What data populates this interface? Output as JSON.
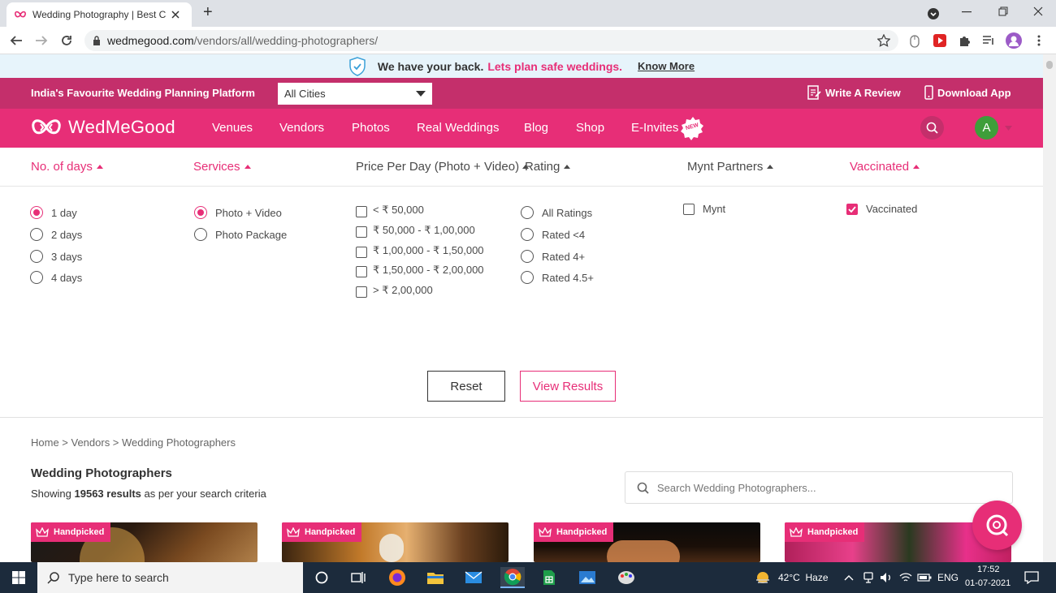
{
  "browser": {
    "tab_title": "Wedding Photography | Best Ca",
    "url_host": "wedmegood.com",
    "url_path": "/vendors/all/wedding-photographers/",
    "new_tab_symbol": "+",
    "window_controls": [
      "minimize",
      "restore",
      "close"
    ]
  },
  "notice": {
    "bold_text": "We have your back.",
    "pink_text": "Lets plan safe weddings.",
    "link_text": "Know More"
  },
  "topbar": {
    "tagline": "India's Favourite Wedding Planning Platform",
    "city_select": "All Cities",
    "write_review": "Write A Review",
    "download_app": "Download App"
  },
  "nav": {
    "logo_text": "WedMeGood",
    "links": [
      "Venues",
      "Vendors",
      "Photos",
      "Real Weddings",
      "Blog",
      "Shop",
      "E-Invites"
    ],
    "new_badge": "NEW",
    "avatar_initial": "A"
  },
  "filters": {
    "headers": [
      "No. of days",
      "Services",
      "Price Per Day (Photo + Video)",
      "Rating",
      "Mynt Partners",
      "Vaccinated"
    ],
    "days": [
      {
        "label": "1 day",
        "selected": true
      },
      {
        "label": "2 days",
        "selected": false
      },
      {
        "label": "3 days",
        "selected": false
      },
      {
        "label": "4 days",
        "selected": false
      }
    ],
    "services": [
      {
        "label": "Photo + Video",
        "selected": true
      },
      {
        "label": "Photo Package",
        "selected": false
      }
    ],
    "price": [
      {
        "label": "< ₹ 50,000",
        "checked": false
      },
      {
        "label": "₹ 50,000 - ₹ 1,00,000",
        "checked": false
      },
      {
        "label": "₹ 1,00,000 - ₹ 1,50,000",
        "checked": false
      },
      {
        "label": "₹ 1,50,000 - ₹ 2,00,000",
        "checked": false
      },
      {
        "label": "> ₹ 2,00,000",
        "checked": false
      }
    ],
    "rating": [
      {
        "label": "All Ratings",
        "selected": false
      },
      {
        "label": "Rated <4",
        "selected": false
      },
      {
        "label": "Rated 4+",
        "selected": false
      },
      {
        "label": "Rated 4.5+",
        "selected": false
      }
    ],
    "mynt": {
      "label": "Mynt",
      "checked": false
    },
    "vaccinated": {
      "label": "Vaccinated",
      "checked": true
    },
    "reset_label": "Reset",
    "view_results_label": "View Results"
  },
  "listing": {
    "breadcrumb": "Home > Vendors > Wedding Photographers",
    "title": "Wedding Photographers",
    "showing_prefix": "Showing",
    "result_count": "19563 results",
    "showing_suffix": "as per your search criteria",
    "search_placeholder": "Search Wedding Photographers...",
    "card_badge": "Handpicked"
  },
  "taskbar": {
    "search_placeholder": "Type here to search",
    "weather": "42°C  Haze",
    "language": "ENG",
    "time": "17:52",
    "date": "01-07-2021"
  },
  "colors": {
    "brand_pink": "#e72e77",
    "dark_pink": "#c42f6b",
    "notice_bg": "#e7f4fb"
  }
}
